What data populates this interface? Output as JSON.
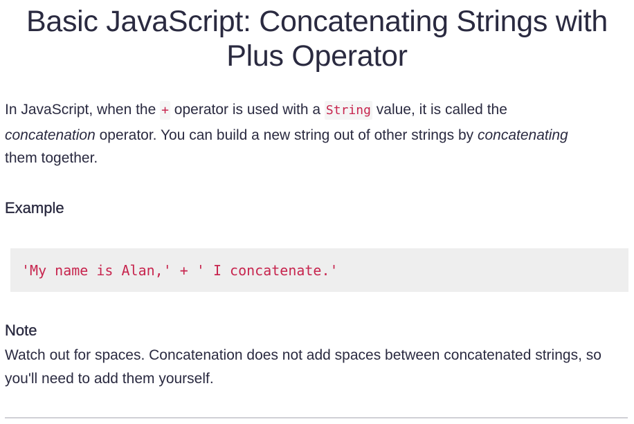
{
  "lesson": {
    "title": "Basic JavaScript: Concatenating Strings with Plus Operator"
  },
  "description": {
    "intro": "In JavaScript, when the ",
    "plus_code": "+",
    "mid": " operator is used with a ",
    "string_code": "String",
    "after_string": " value, it is called the",
    "term_concatenation": "concatenation",
    "sentence2": " operator. You can build a new string out of other strings by ",
    "term_concatenating": "concatenating",
    "ending": "them together."
  },
  "example": {
    "heading": "Example",
    "code": "'My name is Alan,' + ' I concatenate.'"
  },
  "note": {
    "heading": "Note",
    "text": "Watch out for spaces. Concatenation does not add spaces between concatenated strings, so you'll need to add them yourself."
  }
}
